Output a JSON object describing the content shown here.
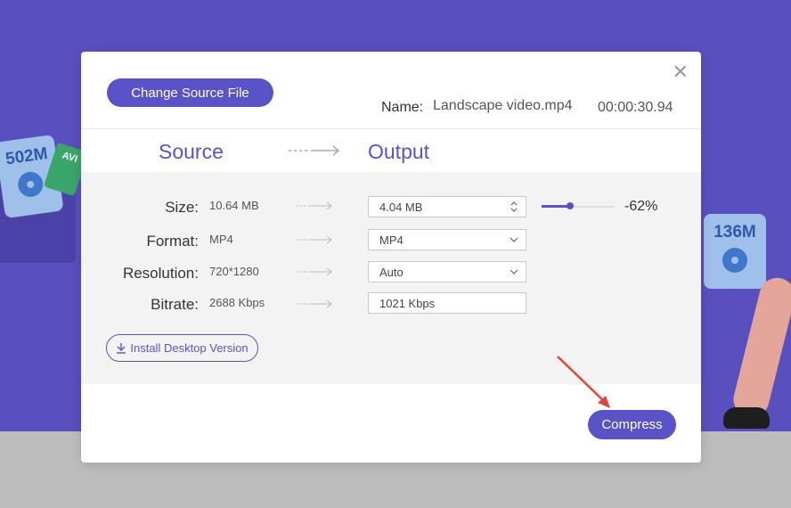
{
  "background": {
    "badge_left_size": "502M",
    "badge_left_format": "AVI",
    "badge_right_size": "136M"
  },
  "dialog": {
    "change_source_label": "Change Source File",
    "name_label": "Name:",
    "file_name": "Landscape video.mp4",
    "duration": "00:00:30.94",
    "source_header": "Source",
    "output_header": "Output",
    "rows": [
      {
        "label": "Size:",
        "source": "10.64  MB",
        "output": "4.04  MB"
      },
      {
        "label": "Format:",
        "source": "MP4",
        "output": "MP4"
      },
      {
        "label": "Resolution:",
        "source": "720*1280",
        "output": "Auto"
      },
      {
        "label": "Bitrate:",
        "source": "2688  Kbps",
        "output": "1021 Kbps"
      }
    ],
    "compression_percent": "-62%",
    "install_label": "Install Desktop Version",
    "compress_label": "Compress"
  },
  "colors": {
    "accent": "#5a52c7",
    "background": "#5a4fbf",
    "annotation_arrow": "#e0463a"
  }
}
